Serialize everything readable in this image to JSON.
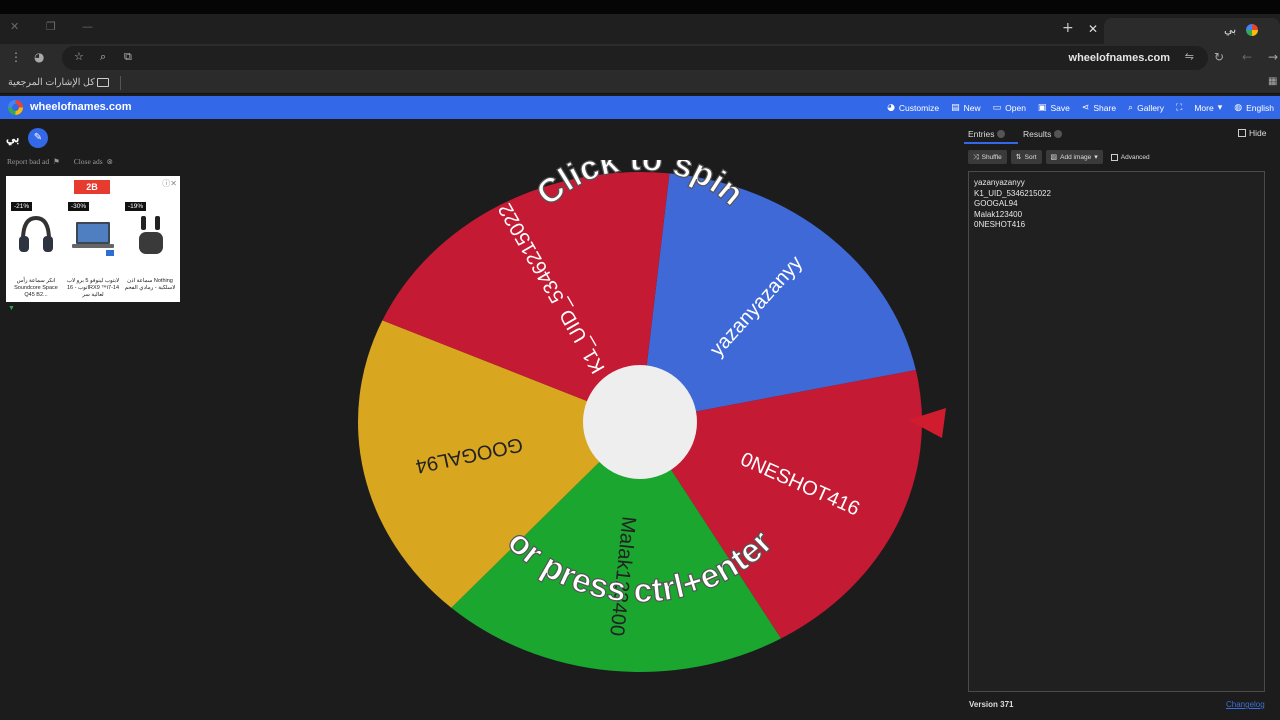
{
  "browser": {
    "tab_title": "بي",
    "url": "wheelofnames.com",
    "bookmarks_label": "كل الإشارات المرجعية"
  },
  "site": {
    "name": "wheelofnames.com",
    "nav": [
      {
        "label": "Customize",
        "icon": "palette-icon"
      },
      {
        "label": "New",
        "icon": "file-icon"
      },
      {
        "label": "Open",
        "icon": "folder-icon"
      },
      {
        "label": "Save",
        "icon": "save-icon"
      },
      {
        "label": "Share",
        "icon": "share-icon"
      },
      {
        "label": "Gallery",
        "icon": "search-icon"
      },
      {
        "label": "",
        "icon": "fullscreen-icon"
      },
      {
        "label": "More",
        "icon": "chevron-down-icon"
      },
      {
        "label": "English",
        "icon": "globe-icon"
      }
    ]
  },
  "left": {
    "title": "بي",
    "report_ad": "Report bad ad",
    "close_ads": "Close ads",
    "ad": {
      "brand": "2B",
      "products": [
        {
          "discount": "-21%",
          "caption": "انكر سماعة رأس Soundcore Space Q45 B2..."
        },
        {
          "discount": "-30%",
          "caption": "لابتوب لينوفو 5 برو لاب توب - 16IRX9 ™i7-14 لعالية سر"
        },
        {
          "discount": "-19%",
          "caption": "سماعة اذن Nothing لاسلكية - رمادي الفحم"
        }
      ]
    }
  },
  "wheel": {
    "segments": [
      {
        "label": "yazanyazanyy",
        "color": "#3f69d6"
      },
      {
        "label": "0NESHOT416",
        "color": "#c41a33"
      },
      {
        "label": "Malak123400",
        "color": "#1aa62f"
      },
      {
        "label": "GOOGAL94",
        "color": "#d9a620"
      },
      {
        "label": "K1_UID_5346215022",
        "color": "#c41a33"
      }
    ],
    "prompt_top": "Click to spin",
    "prompt_bottom": "or press ctrl+enter",
    "pointer_color": "#d01c2e"
  },
  "panel": {
    "tab_entries": "Entries",
    "tab_results": "Results",
    "hide": "Hide",
    "shuffle": "Shuffle",
    "sort": "Sort",
    "add_image": "Add image",
    "advanced": "Advanced",
    "entries": [
      "yazanyazanyy",
      "K1_UID_5346215022",
      "GOOGAL94",
      "Malak123400",
      "0NESHOT416"
    ],
    "version": "Version 371",
    "changelog": "Changelog"
  }
}
